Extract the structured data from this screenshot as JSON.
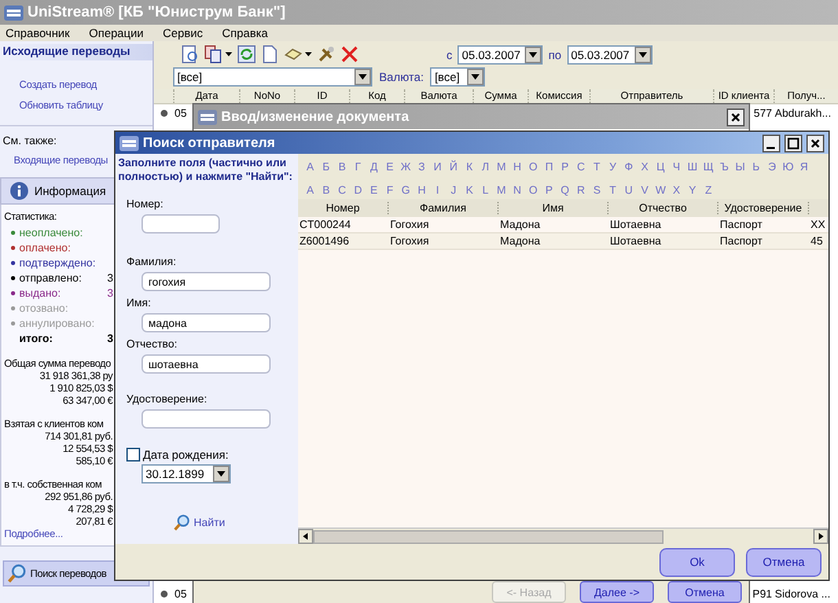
{
  "window": {
    "title": "UniStream® [КБ \"Юниструм Банк\"]"
  },
  "menu": [
    "Справочник",
    "Операции",
    "Сервис",
    "Справка"
  ],
  "sidebar": {
    "header": "Исходящие переводы",
    "actions": [
      "Создать перевод",
      "Обновить таблицу"
    ],
    "see_also_label": "См. также:",
    "see_also_links": [
      "Входящие переводы"
    ],
    "info_header": "Информация",
    "stats_label": "Статистика:",
    "stats": [
      {
        "label": "неоплачено:",
        "color": "#3a8a3a"
      },
      {
        "label": "оплачено:",
        "color": "#b03030"
      },
      {
        "label": "подтверждено:",
        "color": "#3434a0"
      },
      {
        "label": "отправлено:",
        "color": "#000000",
        "value": "3"
      },
      {
        "label": "выдано:",
        "color": "#8a2a8a",
        "value": "3"
      },
      {
        "label": "отозвано:",
        "color": "#9a9a9a"
      },
      {
        "label": "аннулировано:",
        "color": "#9a9a9a"
      }
    ],
    "total": {
      "label": "итого:",
      "value": "3"
    },
    "sums": [
      {
        "title": "Общая сумма переводо",
        "amounts": [
          "31 918 361,38 ру",
          "1 910 825,03 $",
          "63 347,00 €"
        ]
      },
      {
        "title": "Взятая с клиентов ком",
        "amounts": [
          "714 301,81 руб.",
          "12 554,53 $",
          "585,10 €"
        ]
      },
      {
        "title": "в т.ч. собственная ком",
        "amounts": [
          "292 951,86 руб.",
          "4 728,29 $",
          "207,81 €"
        ]
      }
    ],
    "more_link": "Подробнее...",
    "search_button": "Поиск переводов"
  },
  "date_filter": {
    "from_label": "с",
    "from": "05.03.2007",
    "to_label": "по",
    "to": "05.03.2007"
  },
  "filter": {
    "status": "[все]",
    "currency_label": "Валюта:",
    "currency": "[все]"
  },
  "table": {
    "columns": [
      "Дата",
      "NoNo",
      "ID",
      "Код",
      "Валюта",
      "Сумма",
      "Комиссия",
      "Отправитель",
      "ID клиента",
      "Получ..."
    ],
    "rows_top": [
      {
        "date": "05",
        "client": "577",
        "recipient": "Abdurakh..."
      }
    ],
    "rows_bottom": [
      {
        "date": "05",
        "client": "P91",
        "recipient": "Sidorova ..."
      }
    ]
  },
  "document_dialog": {
    "title": "Ввод/изменение документа",
    "buttons": [
      {
        "label": "<- Назад",
        "disabled": true
      },
      {
        "label": "Далее ->",
        "disabled": false
      },
      {
        "label": "Отмена",
        "disabled": false
      }
    ]
  },
  "search_dialog": {
    "title": "Поиск отправителя",
    "instructions": "Заполните поля (частично или полностью) и нажмите \"Найти\":",
    "fields": [
      {
        "label": "Номер:",
        "kind": "short"
      },
      {
        "label": "Фамилия:",
        "value": "гогохия",
        "kind": "long"
      },
      {
        "label": "Имя:",
        "value": "мадона",
        "kind": "long"
      },
      {
        "label": "Отчество:",
        "value": "шотаевна",
        "kind": "long"
      },
      {
        "label": "Удостоверение:",
        "kind": "long"
      }
    ],
    "birth_date": {
      "label": "Дата рождения:",
      "checked": false,
      "value": "30.12.1899"
    },
    "find_link": "Найти",
    "cyrillic_letters": [
      "А",
      "Б",
      "В",
      "Г",
      "Д",
      "Е",
      "Ж",
      "З",
      "И",
      "Й",
      "К",
      "Л",
      "М",
      "Н",
      "О",
      "П",
      "Р",
      "С",
      "Т",
      "У",
      "Ф",
      "Х",
      "Ц",
      "Ч",
      "Ш",
      "Щ",
      "Ъ",
      "Ы",
      "Ь",
      "Э",
      "Ю",
      "Я"
    ],
    "latin_letters": [
      "A",
      "B",
      "C",
      "D",
      "E",
      "F",
      "G",
      "H",
      "I",
      "J",
      "K",
      "L",
      "M",
      "N",
      "O",
      "P",
      "Q",
      "R",
      "S",
      "T",
      "U",
      "V",
      "W",
      "X",
      "Y",
      "Z"
    ],
    "results": {
      "columns": [
        "Номер",
        "Фамилия",
        "Имя",
        "Отчество",
        "Удостоверение"
      ],
      "rows": [
        {
          "cells": [
            "CT000244",
            "Гогохия",
            "Мадона",
            "Шотаевна",
            "Паспорт",
            "XX"
          ]
        },
        {
          "cells": [
            "Z6001496",
            "Гогохия",
            "Мадона",
            "Шотаевна",
            "Паспорт",
            "45"
          ]
        }
      ]
    },
    "buttons": [
      "Ok",
      "Отмена"
    ]
  }
}
